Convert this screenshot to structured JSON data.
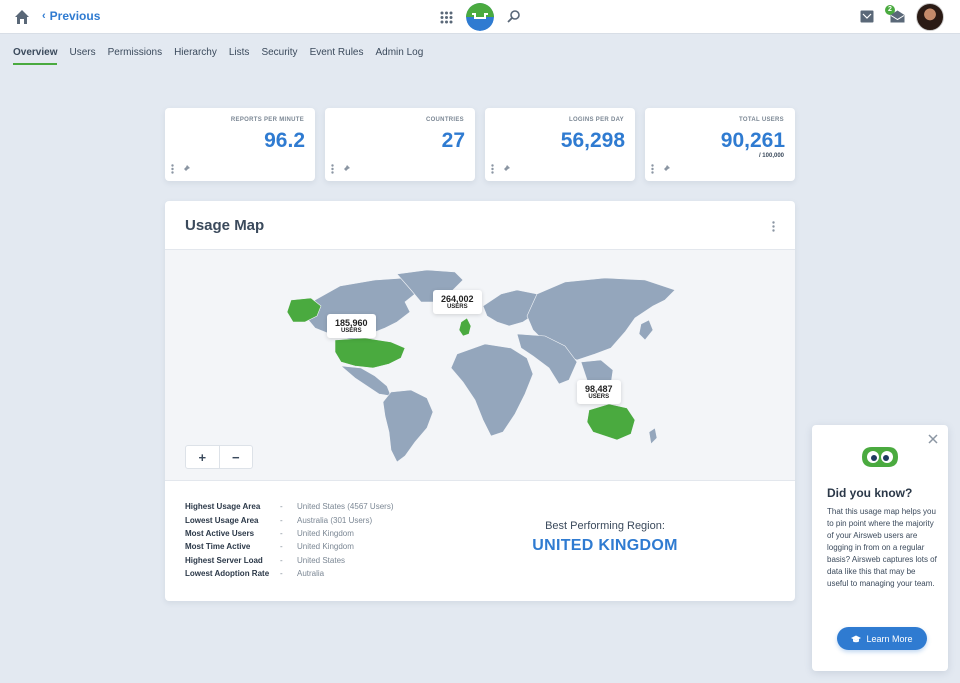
{
  "topbar": {
    "previous_label": "Previous",
    "notification_count": "2",
    "icons": [
      "home-icon",
      "chevron-left-icon",
      "apps-grid-icon",
      "app-logo",
      "search-icon",
      "inbox-icon",
      "mail-icon",
      "avatar"
    ]
  },
  "tabs": [
    {
      "label": "Overview",
      "active": true
    },
    {
      "label": "Users"
    },
    {
      "label": "Permissions"
    },
    {
      "label": "Hierarchy"
    },
    {
      "label": "Lists"
    },
    {
      "label": "Security"
    },
    {
      "label": "Event Rules"
    },
    {
      "label": "Admin Log"
    }
  ],
  "cards": [
    {
      "label": "REPORTS PER MINUTE",
      "value": "96.2",
      "sub": ""
    },
    {
      "label": "COUNTRIES",
      "value": "27",
      "sub": ""
    },
    {
      "label": "LOGINS PER DAY",
      "value": "56,298",
      "sub": ""
    },
    {
      "label": "TOTAL USERS",
      "value": "90,261",
      "sub": "/ 100,000"
    }
  ],
  "usage_map": {
    "title": "Usage Map",
    "callouts": [
      {
        "value": "185,960",
        "unit": "USERS"
      },
      {
        "value": "264,002",
        "unit": "USERS"
      },
      {
        "value": "98,487",
        "unit": "USERS"
      }
    ],
    "zoom_in": "+",
    "zoom_out": "−",
    "colors": {
      "land": "#94a6bc",
      "highlight": "#4aaa3f",
      "accent": "#2f7bd1"
    }
  },
  "stats": [
    {
      "key": "Highest Usage Area",
      "dash": "-",
      "value": "United States (4567 Users)"
    },
    {
      "key": "Lowest Usage Area",
      "dash": "-",
      "value": "Australia (301 Users)"
    },
    {
      "key": "Most Active Users",
      "dash": "-",
      "value": "United Kingdom"
    },
    {
      "key": "Most Time Active",
      "dash": "-",
      "value": "United Kingdom"
    },
    {
      "key": "Highest Server Load",
      "dash": "-",
      "value": "United States"
    },
    {
      "key": "Lowest Adoption Rate",
      "dash": "-",
      "value": "Autralia"
    }
  ],
  "best_region": {
    "label": "Best Performing Region:",
    "value": "UNITED KINGDOM"
  },
  "did_you_know": {
    "title": "Did you know?",
    "body": "That this usage map helps you to pin point where the majority of your Airsweb users are logging in from on a regular basis? Airsweb captures lots of data like this that may be useful to managing your team.",
    "button_label": "Learn More"
  }
}
